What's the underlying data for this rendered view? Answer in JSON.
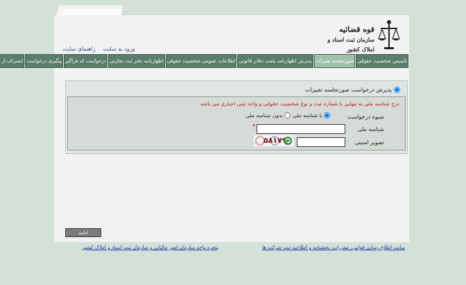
{
  "header": {
    "logo_title": "قوه قضائیه",
    "logo_subtitle": "سازمان ثبت اسناد و املاک کشور",
    "links": [
      "ورود به سایت",
      "راهنمای سایت"
    ]
  },
  "nav": {
    "items": [
      {
        "label": "تأسیس شخصیت حقوقی",
        "active": false
      },
      {
        "label": "صورتجلسه تغییرات",
        "active": true
      },
      {
        "label": "پذیرش اظهارنامه پلمب دفاتر قانونی",
        "active": false
      },
      {
        "label": "اطلاعات عمومی شخصیت حقوقی",
        "active": false
      },
      {
        "label": "اظهارنامه دفتر ثبت تجارتی",
        "active": false
      },
      {
        "label": "درخواست کد فراگیر",
        "active": false
      },
      {
        "label": "پیگیری درخواست",
        "active": false
      },
      {
        "label": "انصراف از درخواست",
        "active": false
      }
    ]
  },
  "form": {
    "main_option_label": "پذیرش درخواست صورتجلسه تغییرات",
    "notice": "درج شناسه ملی به تنهایی یا شماره ثبت و نوع شخصیت حقوقی و واحد ثبتی اجباری می باشد",
    "request_method_label": "شیوه درخواست",
    "option_with_id": "با شناسه ملی",
    "option_without_id": "بدون شناسه ملی",
    "national_id_label": "شناسه ملی",
    "national_id_value": "",
    "required_mark": "*",
    "captcha_label": "تصویر امنیتی",
    "captcha_value": "",
    "captcha_text": "۵۸۱۷۹"
  },
  "actions": {
    "continue_label": "ادامه"
  },
  "footer": {
    "link_left": "پنجره واحد سازمان امور مالیاتی و سازمان ثبت اسناد و املاک کشور",
    "link_right": "سایت اطلاع رسانی قوانین، مقررات، بخشنامه و اطلاعیه ثبت شرکت ها"
  },
  "colors": {
    "nav_bg": "#5a7e6b",
    "nav_active": "#9fc1aa",
    "notice_text": "#b02020",
    "link": "#1d2f9c"
  }
}
